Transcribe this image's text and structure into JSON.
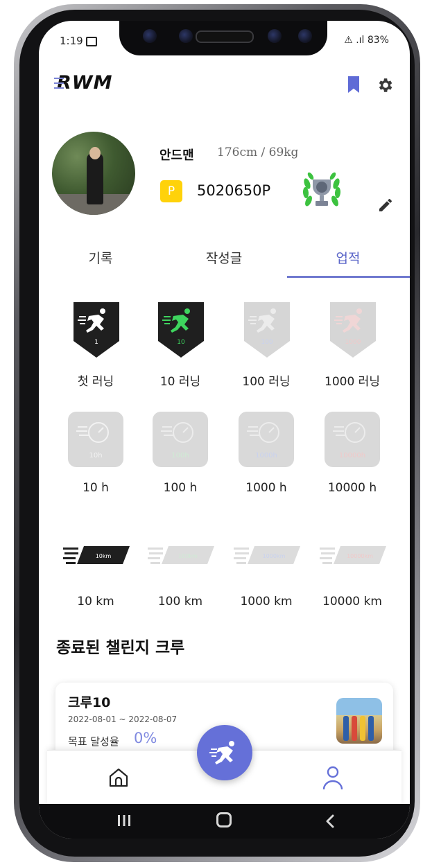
{
  "status_bar": {
    "time": "1:19",
    "right": "⚠ .ıl 83%"
  },
  "header": {
    "logo": "RWM"
  },
  "profile": {
    "name": "안드맨",
    "meta": "176cm / 69kg",
    "points_badge": "P",
    "points": "5020650P"
  },
  "tabs": [
    {
      "label": "기록"
    },
    {
      "label": "작성글"
    },
    {
      "label": "업적",
      "active": true
    }
  ],
  "achievements": {
    "running": [
      {
        "label": "첫 러닝",
        "number": "1"
      },
      {
        "label": "10 러닝",
        "number": "10"
      },
      {
        "label": "100 러닝",
        "number": "100"
      },
      {
        "label": "1000 러닝",
        "number": "1000"
      }
    ],
    "hours": [
      {
        "label": "10 h",
        "badge": "10h"
      },
      {
        "label": "100 h",
        "badge": "100h"
      },
      {
        "label": "1000 h",
        "badge": "1000h"
      },
      {
        "label": "10000 h",
        "badge": "10000h"
      }
    ],
    "distance": [
      {
        "label": "10 km",
        "badge": "10km"
      },
      {
        "label": "100 km",
        "badge": "100km"
      },
      {
        "label": "1000 km",
        "badge": "1000km"
      },
      {
        "label": "10000 km",
        "badge": "10000km"
      }
    ]
  },
  "section": {
    "title": "종료된 챌린지 크루"
  },
  "crew": {
    "name": "크루10",
    "dates": "2022-08-01 ~ 2022-08-07",
    "goal_label": "목표 달성율",
    "goal_value": "0%"
  },
  "colors": {
    "accent": "#6570d8",
    "active_tab": "#5c67c9",
    "gold": "#ffd20a",
    "laurel": "#3cc23f",
    "unlocked_green": "#3ed45e"
  }
}
